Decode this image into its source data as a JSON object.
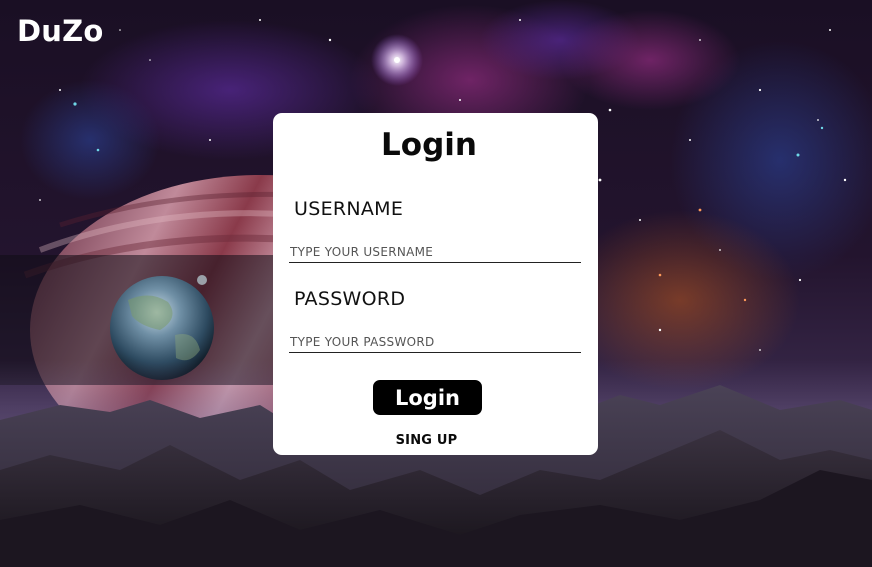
{
  "brand": {
    "name": "DuZo"
  },
  "login_card": {
    "title": "Login",
    "username": {
      "label": "USERNAME",
      "placeholder": "TYPE YOUR USERNAME",
      "value": ""
    },
    "password": {
      "label": "PASSWORD",
      "placeholder": "TYPE YOUR PASSWORD",
      "value": ""
    },
    "login_button_label": "Login",
    "signup_link_label": "SING UP"
  },
  "background": {
    "description_icon": "space-landscape-image"
  },
  "colors": {
    "card_background": "#ffffff",
    "button_background": "#000000",
    "button_text": "#ffffff",
    "brand_text": "#ffffff"
  }
}
